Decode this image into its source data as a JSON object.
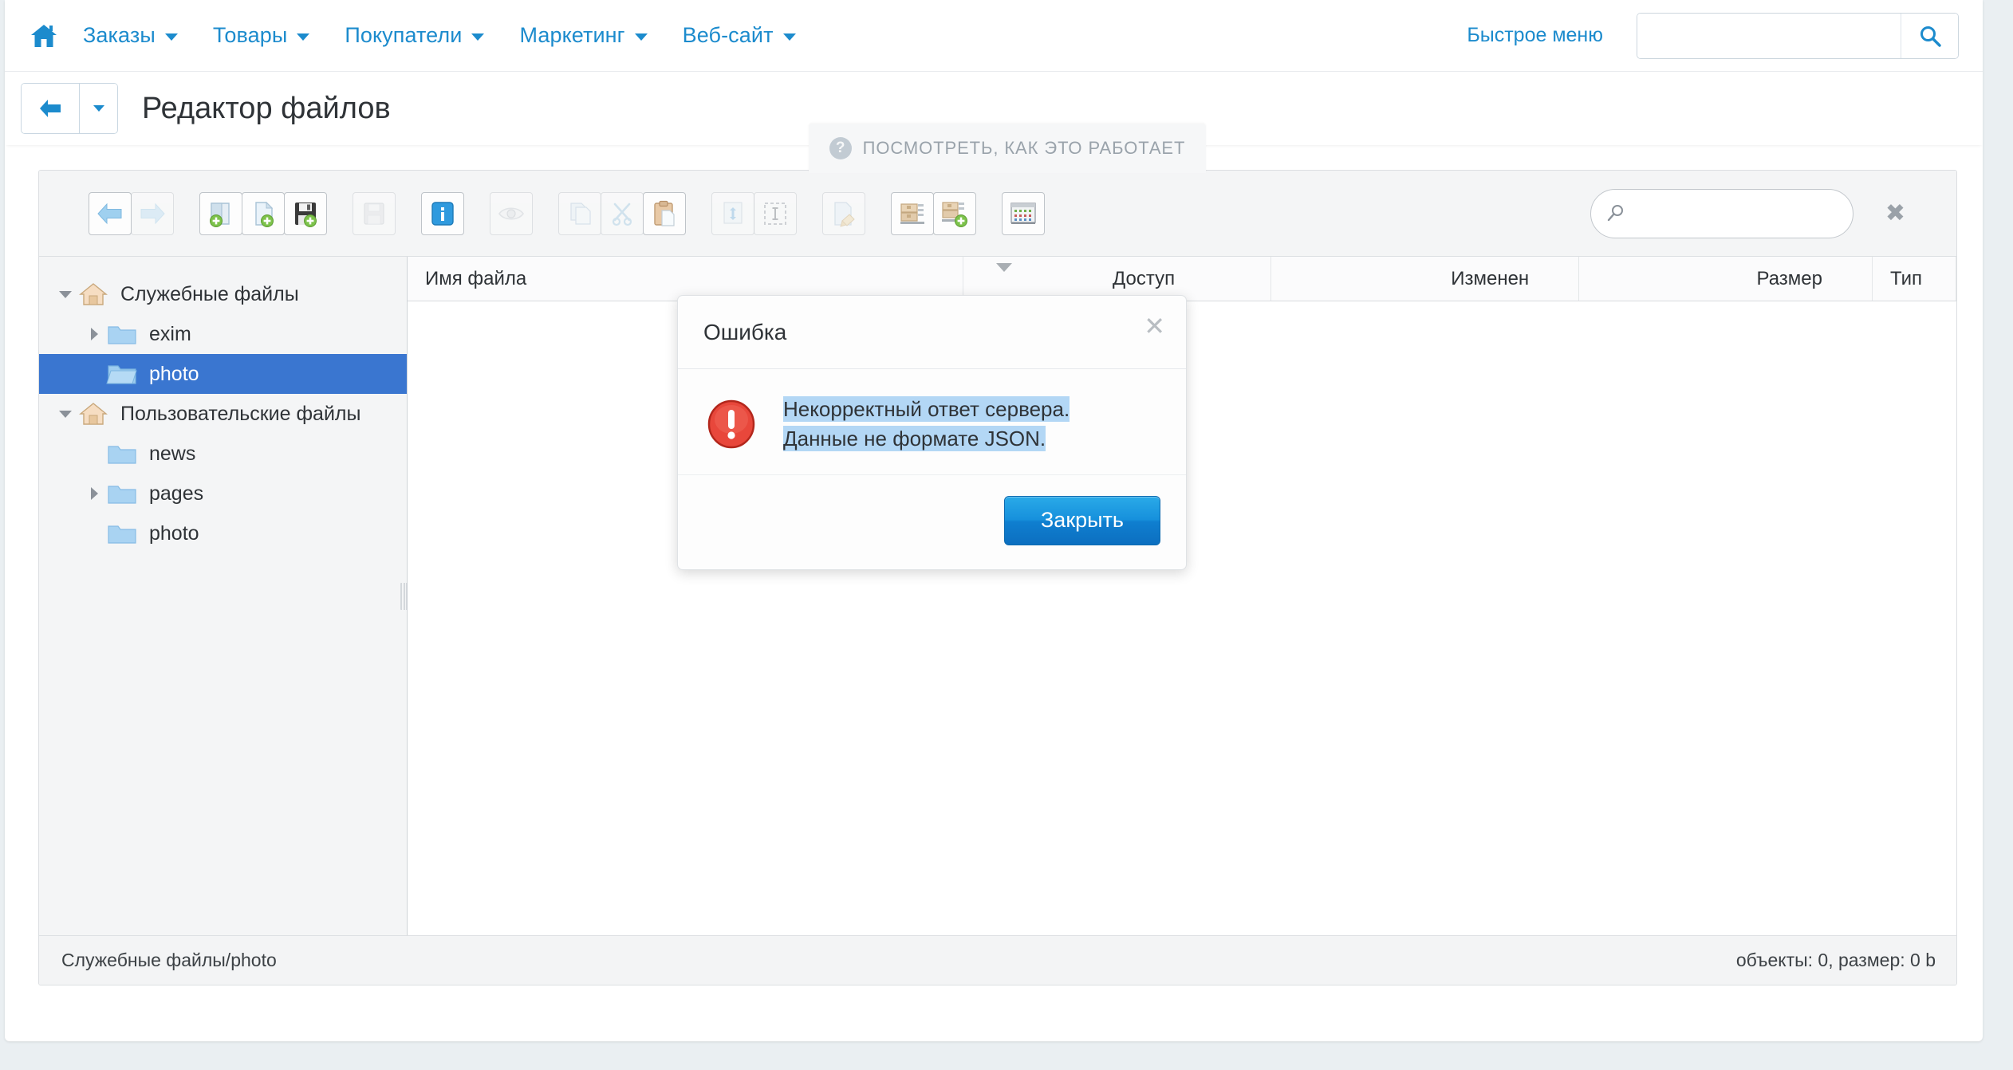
{
  "topnav": {
    "home_icon": "home-icon",
    "items": [
      {
        "label": "Заказы",
        "has_caret": true
      },
      {
        "label": "Товары",
        "has_caret": true
      },
      {
        "label": "Покупатели",
        "has_caret": true
      },
      {
        "label": "Маркетинг",
        "has_caret": true
      },
      {
        "label": "Веб-сайт",
        "has_caret": true
      }
    ],
    "quick_menu": "Быстрое меню",
    "search_value": "",
    "search_placeholder": "",
    "search_icon": "magnifier-icon"
  },
  "page_header": {
    "back_icon": "arrow-left-icon",
    "back_dropdown_icon": "caret-down-icon",
    "title": "Редактор файлов"
  },
  "howto": {
    "label": "ПОСМОТРЕТЬ, КАК ЭТО РАБОТАЕТ",
    "icon": "question-circle-icon"
  },
  "toolbar": {
    "buttons": [
      {
        "name": "nav-back-button",
        "icon": "arrow-left-blue-icon",
        "disabled": false
      },
      {
        "name": "nav-forward-button",
        "icon": "arrow-right-blue-icon",
        "disabled": true
      },
      {
        "name": "new-folder-button",
        "icon": "folder-add-icon",
        "disabled": false
      },
      {
        "name": "new-file-button",
        "icon": "file-add-icon",
        "disabled": false
      },
      {
        "name": "upload-file-button",
        "icon": "floppy-add-icon",
        "disabled": false
      },
      {
        "name": "save-button",
        "icon": "floppy-icon",
        "disabled": true
      },
      {
        "name": "info-button",
        "icon": "info-blue-icon",
        "disabled": false
      },
      {
        "name": "preview-button",
        "icon": "eye-icon",
        "disabled": true
      },
      {
        "name": "copy-button",
        "icon": "copy-documents-icon",
        "disabled": true
      },
      {
        "name": "cut-button",
        "icon": "scissors-icon",
        "disabled": true
      },
      {
        "name": "paste-button",
        "icon": "clipboard-paste-icon",
        "disabled": false
      },
      {
        "name": "move-button",
        "icon": "move-arrows-icon",
        "disabled": true
      },
      {
        "name": "select-all-button",
        "icon": "select-text-icon",
        "disabled": true
      },
      {
        "name": "rename-button",
        "icon": "file-pencil-icon",
        "disabled": true
      },
      {
        "name": "archive-button",
        "icon": "archive-icon",
        "disabled": false
      },
      {
        "name": "archive-add-button",
        "icon": "archive-add-icon",
        "disabled": false
      },
      {
        "name": "view-mode-button",
        "icon": "grid-view-icon",
        "disabled": false
      }
    ],
    "search_value": "",
    "search_placeholder": "",
    "search_icon": "magnifier-small-icon",
    "clear_icon": "close-x-icon"
  },
  "columns": [
    {
      "label": "Имя файла",
      "key": "name"
    },
    {
      "label": "Доступ",
      "key": "access"
    },
    {
      "label": "Изменен",
      "key": "modified"
    },
    {
      "label": "Размер",
      "key": "size"
    },
    {
      "label": "Тип",
      "key": "type"
    }
  ],
  "rows": [],
  "tree": [
    {
      "label": "Служебные файлы",
      "icon": "home-folder-icon",
      "level": 0,
      "expanded": true,
      "toggle": "down",
      "selected": false
    },
    {
      "label": "exim",
      "icon": "folder-icon",
      "level": 1,
      "expanded": false,
      "toggle": "right",
      "selected": false
    },
    {
      "label": "photo",
      "icon": "folder-open-icon",
      "level": 1,
      "expanded": false,
      "toggle": "none",
      "selected": true
    },
    {
      "label": "Пользовательские файлы",
      "icon": "home-folder-icon",
      "level": 0,
      "expanded": true,
      "toggle": "down",
      "selected": false
    },
    {
      "label": "news",
      "icon": "folder-icon",
      "level": 1,
      "expanded": false,
      "toggle": "none",
      "selected": false
    },
    {
      "label": "pages",
      "icon": "folder-icon",
      "level": 1,
      "expanded": false,
      "toggle": "right",
      "selected": false
    },
    {
      "label": "photo",
      "icon": "folder-icon",
      "level": 1,
      "expanded": false,
      "toggle": "none",
      "selected": false
    }
  ],
  "statusbar": {
    "path": "Служебные файлы/photo",
    "summary": "объекты: 0, размер: 0 b"
  },
  "dialog": {
    "title": "Ошибка",
    "close_icon": "close-x-icon",
    "error_icon": "error-exclamation-icon",
    "message_line1": "Некорректный ответ сервера.",
    "message_line2": "Данные не формате JSON.",
    "button_label": "Закрыть"
  },
  "colors": {
    "brand_blue": "#1c8bcd",
    "selection_blue": "#3a76d0",
    "text_highlight": "#b3d7f5",
    "error_red": "#e03a2f",
    "page_bg": "#eaeff2"
  }
}
